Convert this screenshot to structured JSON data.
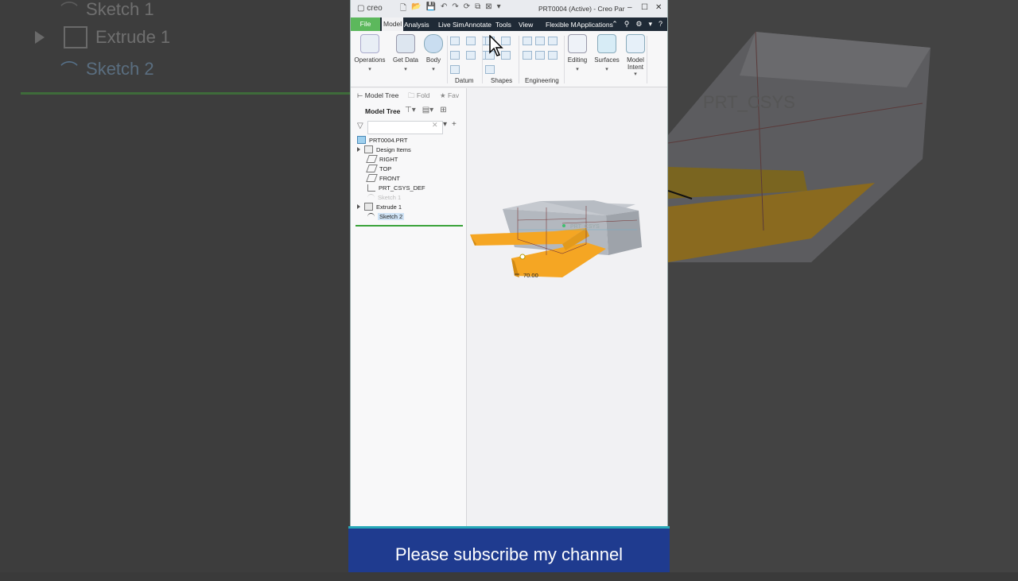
{
  "background_tree": {
    "items": [
      {
        "label": "Sketch 1"
      },
      {
        "label": "Extrude 1"
      },
      {
        "label": "Sketch 2"
      }
    ]
  },
  "background_model": {
    "csys_label": "PRT_CSYS"
  },
  "titlebar": {
    "logo": "creo",
    "title": "PRT0004 (Active) - Creo Par"
  },
  "menu": {
    "file": "File",
    "model": "Model",
    "analysis": "Analysis",
    "live_sim": "Live Sim",
    "annotate": "Annotate",
    "tools": "Tools",
    "view": "View",
    "flexible": "Flexible M",
    "applications": "Applications"
  },
  "ribbon": {
    "operations": "Operations",
    "get_data": "Get Data",
    "body": "Body",
    "datum": "Datum",
    "shapes": "Shapes",
    "engineering": "Engineering",
    "editing": "Editing",
    "surfaces": "Surfaces",
    "model_intent_1": "Model",
    "model_intent_2": "Intent"
  },
  "panel": {
    "tab_model_tree": "Model Tree",
    "tab_folder": "Fold",
    "tab_favorites": "Fav",
    "tree_header": "Model Tree",
    "search_placeholder": ""
  },
  "tree": {
    "items": [
      {
        "label": "PRT0004.PRT"
      },
      {
        "label": "Design Items"
      },
      {
        "label": "RIGHT"
      },
      {
        "label": "TOP"
      },
      {
        "label": "FRONT"
      },
      {
        "label": "PRT_CSYS_DEF"
      },
      {
        "label": "Sketch 1"
      },
      {
        "label": "Extrude 1"
      },
      {
        "label": "Sketch 2"
      }
    ]
  },
  "viewport": {
    "dimension": "70.00",
    "csys_label": "PRT_CSYS"
  },
  "caption": "Please subscribe my channel",
  "colors": {
    "menubar": "#1f2a36",
    "file_tab": "#5cb85c",
    "extrude_orange": "#f5a623",
    "caption_bg": "#1f3b8f"
  }
}
